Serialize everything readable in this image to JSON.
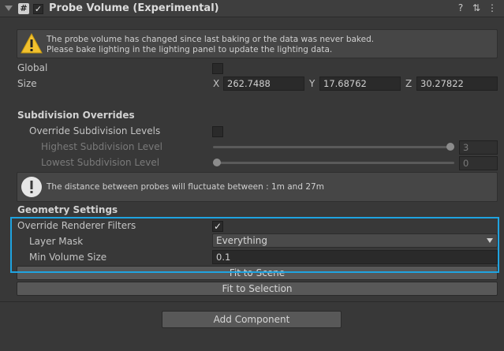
{
  "component": {
    "title": "Probe Volume (Experimental)",
    "enabled_check": "✓"
  },
  "warning": {
    "line1": "The probe volume has changed since last baking or the data was never baked.",
    "line2": "Please bake lighting in the lighting panel to update the lighting data."
  },
  "fields": {
    "global_label": "Global",
    "size_label": "Size",
    "size_x_label": "X",
    "size_x": "262.7488",
    "size_y_label": "Y",
    "size_y": "17.68762",
    "size_z_label": "Z",
    "size_z": "30.27822"
  },
  "subdivision": {
    "header": "Subdivision Overrides",
    "override_label": "Override Subdivision Levels",
    "highest_label": "Highest Subdivision Level",
    "highest_value": "3",
    "highest_fraction": 1.0,
    "lowest_label": "Lowest Subdivision Level",
    "lowest_value": "0",
    "lowest_fraction": 0.0
  },
  "info": {
    "text": "The distance between probes will fluctuate between : 1m and 27m"
  },
  "geometry": {
    "header": "Geometry Settings",
    "override_filters_label": "Override Renderer Filters",
    "override_filters_check": "✓",
    "layer_mask_label": "Layer Mask",
    "layer_mask_value": "Everything",
    "min_volume_label": "Min Volume Size",
    "min_volume_value": "0.1"
  },
  "buttons": {
    "fit_scene": "Fit to Scene",
    "fit_selection": "Fit to Selection",
    "add_component": "Add Component"
  },
  "icons": {
    "help": "?",
    "settings": "⇅",
    "menu": "⋮",
    "warning": "!",
    "info": "!",
    "hash": "#"
  },
  "colors": {
    "highlight": "#1fa3e0",
    "warning_icon": "#f2c12e"
  }
}
